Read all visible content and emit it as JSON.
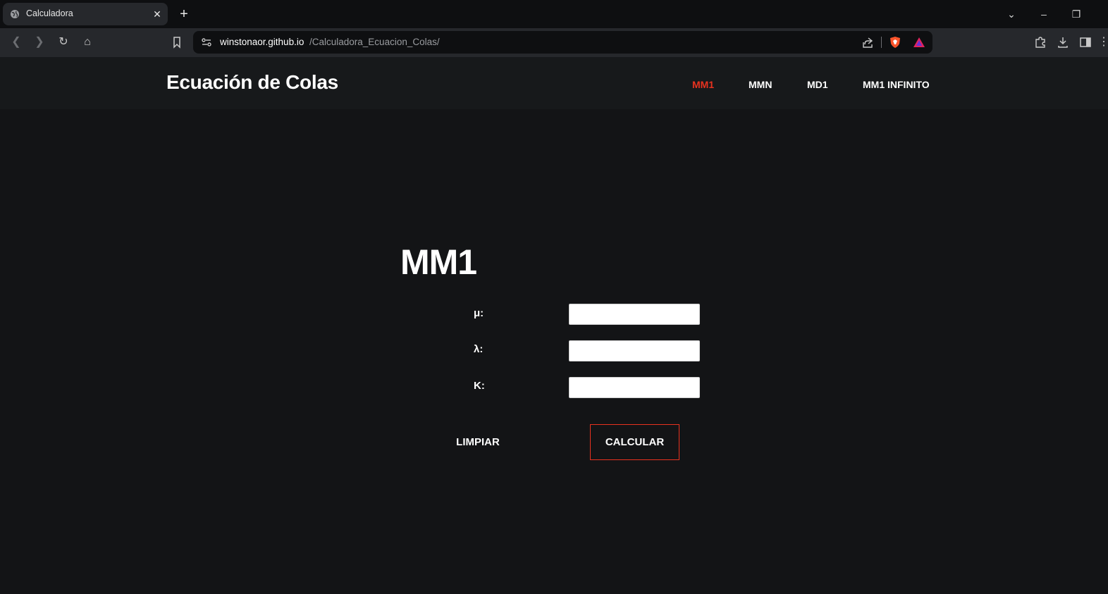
{
  "browser": {
    "tab_title": "Calculadora",
    "tab_close_glyph": "✕",
    "new_tab_glyph": "+",
    "url_host": "winstonaor.github.io",
    "url_path": "/Calculadora_Ecuacion_Colas/",
    "window": {
      "tab_list_glyph": "⌄",
      "minimize_glyph": "–",
      "restore_glyph": "❐"
    },
    "toolbar": {
      "back_glyph": "❮",
      "forward_glyph": "❯",
      "reload_glyph": "↻",
      "home_glyph": "⌂",
      "bookmark_glyph": "⌑"
    }
  },
  "site": {
    "title": "Ecuación de Colas",
    "nav": [
      {
        "label": "MM1",
        "active": true
      },
      {
        "label": "MMN",
        "active": false
      },
      {
        "label": "MD1",
        "active": false
      },
      {
        "label": "MM1 INFINITO",
        "active": false
      }
    ],
    "accent_color": "#e8321f"
  },
  "form": {
    "heading": "MM1",
    "fields": [
      {
        "label": "μ:",
        "value": ""
      },
      {
        "label": "λ:",
        "value": ""
      },
      {
        "label": "K:",
        "value": ""
      }
    ],
    "clear_label": "LIMPIAR",
    "calculate_label": "CALCULAR"
  }
}
